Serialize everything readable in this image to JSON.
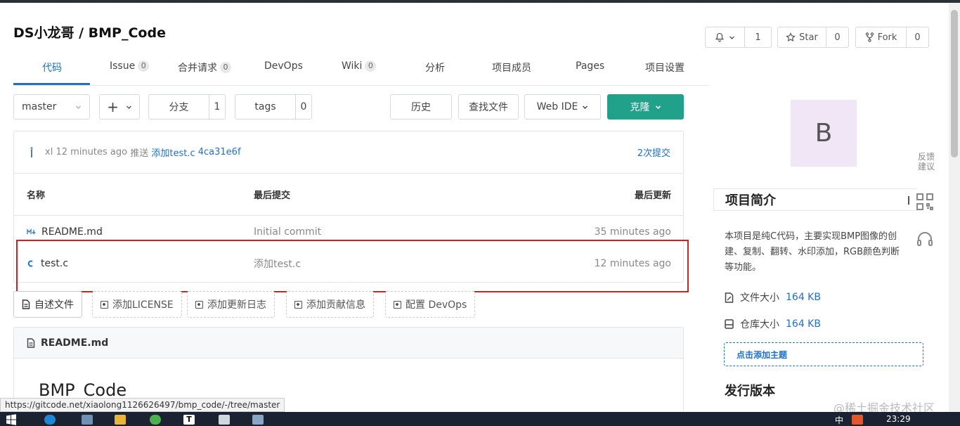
{
  "repo": {
    "owner": "DS小龙哥",
    "separator": "/",
    "name": "BMP_Code"
  },
  "header_buttons": {
    "watch_count": "1",
    "star_label": "Star",
    "star_count": "0",
    "fork_label": "Fork",
    "fork_count": "0"
  },
  "tabs": [
    {
      "label": "代码",
      "badge": ""
    },
    {
      "label": "Issue",
      "badge": "0"
    },
    {
      "label": "合并请求",
      "badge": "0"
    },
    {
      "label": "DevOps",
      "badge": ""
    },
    {
      "label": "Wiki",
      "badge": "0"
    },
    {
      "label": "分析",
      "badge": ""
    },
    {
      "label": "项目成员",
      "badge": ""
    },
    {
      "label": "Pages",
      "badge": ""
    },
    {
      "label": "项目设置",
      "badge": ""
    }
  ],
  "toolbar": {
    "branch": "master",
    "plus": "+",
    "branches_label": "分支",
    "branches_count": "1",
    "tags_label": "tags",
    "tags_count": "0",
    "history": "历史",
    "find_file": "查找文件",
    "web_ide": "Web IDE",
    "clone": "克隆"
  },
  "latest_commit": {
    "author": "xl",
    "time": "12 minutes ago",
    "action": "推送",
    "message": "添加test.c",
    "sha": "4ca31e6f",
    "commits_link": "2次提交"
  },
  "file_table": {
    "headers": {
      "name": "名称",
      "last_commit": "最后提交",
      "last_update": "最后更新"
    },
    "rows": [
      {
        "name": "README.md",
        "commit": "Initial commit",
        "updated": "35 minutes ago"
      },
      {
        "name": "test.c",
        "commit": "添加test.c",
        "updated": "12 minutes ago"
      }
    ]
  },
  "actions": [
    "自述文件",
    "添加LICENSE",
    "添加更新日志",
    "添加贡献信息",
    "配置 DevOps"
  ],
  "readme": {
    "filename": "README.md",
    "heading": "BMP_Code"
  },
  "sidebar": {
    "avatar_letter": "B",
    "intro_title": "项目简介",
    "intro_lines": [
      "本项目是纯C代码，主要实现BMP图像的创",
      "建、复制、翻转、水印添加，RGB颜色判断",
      "等功能。"
    ],
    "file_size_label": "文件大小",
    "file_size_value": "164 KB",
    "repo_size_label": "仓库大小",
    "repo_size_value": "164 KB",
    "add_topic": "点击添加主题",
    "releases_title": "发行版本"
  },
  "floating": {
    "feedback": "反馈建议"
  },
  "status_url": "https://gitcode.net/xiaolong1126626497/bmp_code/-/tree/master",
  "watermark": "@稀土掘金技术社区",
  "taskbar": {
    "time": "23:29",
    "ime": "中"
  },
  "colors": {
    "accent": "#1e6fd1",
    "clone": "#21a08a",
    "highlight": "#d62020"
  }
}
